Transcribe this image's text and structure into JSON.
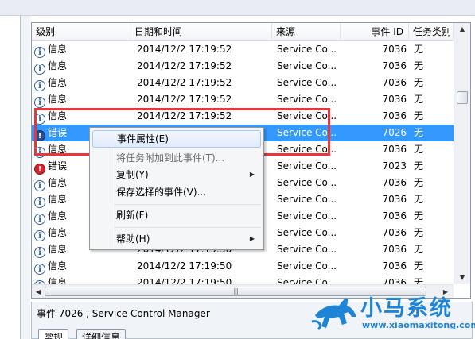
{
  "columns": {
    "level": "级别",
    "datetime": "日期和时间",
    "source": "来源",
    "event_id": "事件 ID",
    "category": "任务类别"
  },
  "rows": [
    {
      "level": "信息",
      "type": "info",
      "datetime": "2014/12/2 17:19:52",
      "source": "Service Co...",
      "event_id": "7036",
      "category": "无"
    },
    {
      "level": "信息",
      "type": "info",
      "datetime": "2014/12/2 17:19:52",
      "source": "Service Co...",
      "event_id": "7036",
      "category": "无"
    },
    {
      "level": "信息",
      "type": "info",
      "datetime": "2014/12/2 17:19:52",
      "source": "Service Co...",
      "event_id": "7036",
      "category": "无"
    },
    {
      "level": "信息",
      "type": "info",
      "datetime": "2014/12/2 17:19:52",
      "source": "Service Co...",
      "event_id": "7036",
      "category": "无"
    },
    {
      "level": "信息",
      "type": "info",
      "datetime": "2014/12/2 17:19:52",
      "source": "Service Co...",
      "event_id": "7036",
      "category": "无"
    },
    {
      "level": "错误",
      "type": "error",
      "datetime": "",
      "source": "Service Co...",
      "event_id": "7026",
      "category": "无",
      "selected": true
    },
    {
      "level": "信息",
      "type": "info",
      "datetime": "",
      "source": "Service Co...",
      "event_id": "7036",
      "category": "无"
    },
    {
      "level": "错误",
      "type": "error",
      "datetime": "",
      "source": "Service Co...",
      "event_id": "7023",
      "category": "无"
    },
    {
      "level": "信息",
      "type": "info",
      "datetime": "",
      "source": "Service Co...",
      "event_id": "7036",
      "category": "无"
    },
    {
      "level": "信息",
      "type": "info",
      "datetime": "",
      "source": "Service Co...",
      "event_id": "7036",
      "category": "无"
    },
    {
      "level": "信息",
      "type": "info",
      "datetime": "",
      "source": "Service Co...",
      "event_id": "7036",
      "category": "无"
    },
    {
      "level": "信息",
      "type": "info",
      "datetime": "",
      "source": "Service Co...",
      "event_id": "7036",
      "category": "无"
    },
    {
      "level": "信息",
      "type": "info",
      "datetime": "2014/12/2 17:19:50",
      "source": "Service Co...",
      "event_id": "7036",
      "category": "无"
    },
    {
      "level": "信息",
      "type": "info",
      "datetime": "2014/12/2 17:19:50",
      "source": "Service Co...",
      "event_id": "7036",
      "category": "无"
    },
    {
      "level": "信息",
      "type": "info",
      "datetime": "2014/12/2 17:19:50",
      "source": "Service Co...",
      "event_id": "7036",
      "category": "无"
    }
  ],
  "context_menu": {
    "event_properties": "事件属性(E)",
    "attach_task": "将任务附加到此事件(T)...",
    "copy": "复制(Y)",
    "save_selected": "保存选择的事件(V)...",
    "refresh": "刷新(F)",
    "help": "帮助(H)"
  },
  "detail": {
    "title": "事件 7026 , Service Control Manager",
    "tab_general": "常规",
    "tab_details": "详细信息"
  },
  "logo": {
    "name": "小马系统",
    "url": "www.xiaomaxitong.com",
    "color": "#1e84d6"
  },
  "colors": {
    "selection": "#3399ff",
    "highlight_box": "#e8373b",
    "error_icon": "#d6252c",
    "info_icon": "#2b5ea8"
  },
  "icons": {
    "info": "info-icon",
    "error": "error-icon",
    "submenu": "chevron-right-icon"
  }
}
